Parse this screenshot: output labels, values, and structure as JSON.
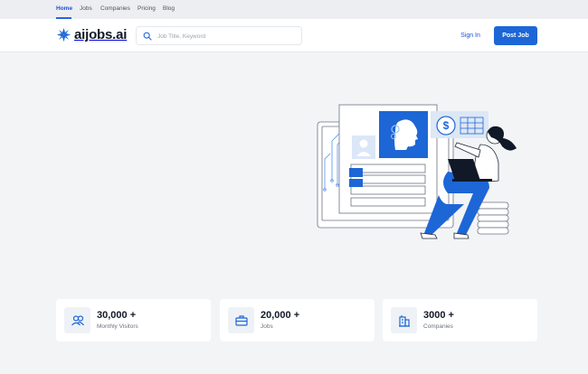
{
  "topnav": {
    "items": [
      {
        "label": "Home",
        "active": true
      },
      {
        "label": "Jobs"
      },
      {
        "label": "Companies"
      },
      {
        "label": "Pricing"
      },
      {
        "label": "Blog"
      }
    ]
  },
  "header": {
    "logo_text": "aijobs.ai",
    "search_placeholder": "Job Title, Keyword",
    "signin_label": "Sign In",
    "postjob_label": "Post Job"
  },
  "stats": [
    {
      "value": "30,000 +",
      "label": "Monthly Visitors",
      "icon": "users-icon"
    },
    {
      "value": "20,000 +",
      "label": "Jobs",
      "icon": "briefcase-icon"
    },
    {
      "value": "3000 +",
      "label": "Companies",
      "icon": "building-icon"
    }
  ],
  "colors": {
    "accent": "#1d66d6",
    "nav_active": "#1d4ed8",
    "background": "#f3f4f6"
  }
}
